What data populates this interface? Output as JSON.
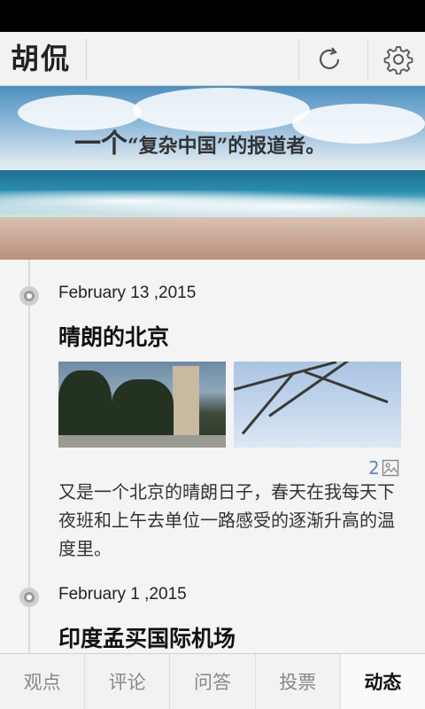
{
  "app": {
    "logo_text": "胡侃"
  },
  "toolbar": {
    "refresh_icon": "refresh-icon",
    "settings_icon": "gear-icon"
  },
  "banner": {
    "tagline_big": "一个",
    "tagline_rest": "“复杂中国”的报道者。"
  },
  "posts": [
    {
      "date": "February 13 ,2015",
      "title": "晴朗的北京",
      "image_count": "2",
      "excerpt": "又是一个北京的晴朗日子，春天在我每天下夜班和上午去单位一路感受的逐渐升高的温度里。"
    },
    {
      "date": "February 1 ,2015",
      "title": "印度孟买国际机场"
    }
  ],
  "tabs": [
    {
      "label": "观点",
      "active": false
    },
    {
      "label": "评论",
      "active": false
    },
    {
      "label": "问答",
      "active": false
    },
    {
      "label": "投票",
      "active": false
    },
    {
      "label": "动态",
      "active": true
    }
  ],
  "colors": {
    "accent_link": "#5b88b5",
    "text_dark": "#111111",
    "tab_inactive": "#888888"
  }
}
